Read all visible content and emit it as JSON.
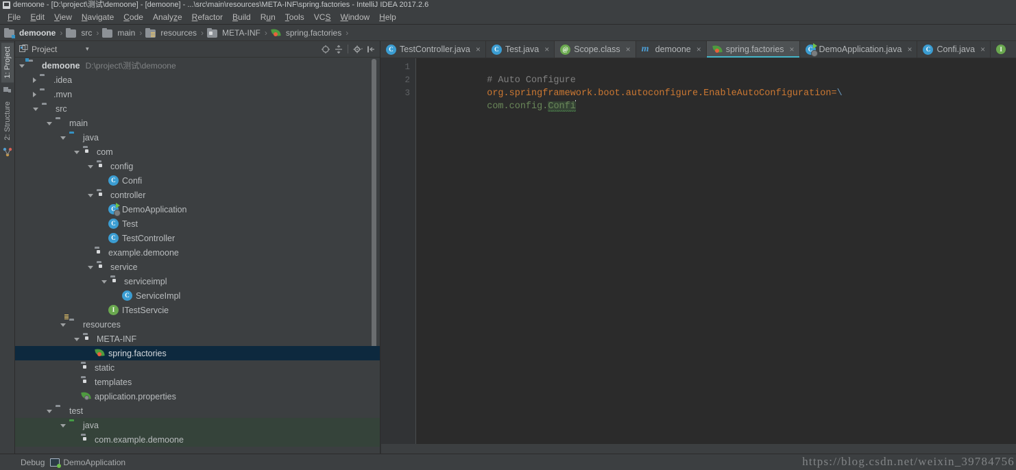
{
  "window": {
    "title": "demoone - [D:\\project\\测试\\demoone] - [demoone] - ...\\src\\main\\resources\\META-INF\\spring.factories - IntelliJ IDEA 2017.2.6",
    "app_icon": "intellij-idea-icon"
  },
  "menubar": {
    "items": [
      {
        "label": "File"
      },
      {
        "label": "Edit"
      },
      {
        "label": "View"
      },
      {
        "label": "Navigate"
      },
      {
        "label": "Code"
      },
      {
        "label": "Analyze"
      },
      {
        "label": "Refactor"
      },
      {
        "label": "Build"
      },
      {
        "label": "Run"
      },
      {
        "label": "Tools"
      },
      {
        "label": "VCS"
      },
      {
        "label": "Window"
      },
      {
        "label": "Help"
      }
    ]
  },
  "navbar": {
    "crumbs": [
      {
        "label": "demoone",
        "icon": "module-folder-icon",
        "bold": true
      },
      {
        "label": "src",
        "icon": "folder-icon",
        "bold": false
      },
      {
        "label": "main",
        "icon": "folder-icon",
        "bold": false
      },
      {
        "label": "resources",
        "icon": "resources-folder-icon",
        "bold": false
      },
      {
        "label": "META-INF",
        "icon": "package-folder-icon",
        "bold": false
      },
      {
        "label": "spring.factories",
        "icon": "spring-leaf-icon",
        "bold": false
      }
    ],
    "separator": "›"
  },
  "toolstrip": {
    "left_tabs": [
      {
        "label": "1: Project",
        "active": true
      },
      {
        "label": "2: Structure",
        "active": false
      }
    ]
  },
  "project_panel": {
    "title": "Project",
    "title_icon": "project-view-icon",
    "dropdown_icon": "chevron-down-icon",
    "toolbar_buttons": [
      {
        "name": "locate-icon",
        "glyph": "⊕"
      },
      {
        "name": "collapse-all-icon",
        "glyph": "≡"
      },
      {
        "name": "settings-gear-icon",
        "glyph": "⚙"
      },
      {
        "name": "hide-panel-icon",
        "glyph": "⇤"
      }
    ],
    "tree": [
      {
        "indent": 0,
        "arrow": "open",
        "icon": "module-folder-icon",
        "label": "demoone",
        "path": "D:\\project\\测试\\demoone",
        "bold": true,
        "selected": false,
        "testmark": false
      },
      {
        "indent": 1,
        "arrow": "closed",
        "icon": "folder-icon",
        "label": ".idea",
        "path": "",
        "bold": false,
        "selected": false,
        "testmark": false
      },
      {
        "indent": 1,
        "arrow": "closed",
        "icon": "folder-icon",
        "label": ".mvn",
        "path": "",
        "bold": false,
        "selected": false,
        "testmark": false
      },
      {
        "indent": 1,
        "arrow": "open",
        "icon": "folder-icon",
        "label": "src",
        "path": "",
        "bold": false,
        "selected": false,
        "testmark": false
      },
      {
        "indent": 2,
        "arrow": "open",
        "icon": "folder-icon",
        "label": "main",
        "path": "",
        "bold": false,
        "selected": false,
        "testmark": false
      },
      {
        "indent": 3,
        "arrow": "open",
        "icon": "source-folder-icon",
        "label": "java",
        "path": "",
        "bold": false,
        "selected": false,
        "testmark": false
      },
      {
        "indent": 4,
        "arrow": "open",
        "icon": "package-folder-icon",
        "label": "com",
        "path": "",
        "bold": false,
        "selected": false,
        "testmark": false
      },
      {
        "indent": 5,
        "arrow": "open",
        "icon": "package-folder-icon",
        "label": "config",
        "path": "",
        "bold": false,
        "selected": false,
        "testmark": false
      },
      {
        "indent": 6,
        "arrow": "none",
        "icon": "java-class-icon",
        "label": "Confi",
        "path": "",
        "bold": false,
        "selected": false,
        "testmark": false
      },
      {
        "indent": 5,
        "arrow": "open",
        "icon": "package-folder-icon",
        "label": "controller",
        "path": "",
        "bold": false,
        "selected": false,
        "testmark": false
      },
      {
        "indent": 6,
        "arrow": "none",
        "icon": "java-runnable-class-icon",
        "label": "DemoApplication",
        "path": "",
        "bold": false,
        "selected": false,
        "testmark": false
      },
      {
        "indent": 6,
        "arrow": "none",
        "icon": "java-class-icon",
        "label": "Test",
        "path": "",
        "bold": false,
        "selected": false,
        "testmark": false
      },
      {
        "indent": 6,
        "arrow": "none",
        "icon": "java-class-icon",
        "label": "TestController",
        "path": "",
        "bold": false,
        "selected": false,
        "testmark": false
      },
      {
        "indent": 5,
        "arrow": "none",
        "icon": "package-folder-icon",
        "label": "example.demoone",
        "path": "",
        "bold": false,
        "selected": false,
        "testmark": false
      },
      {
        "indent": 5,
        "arrow": "open",
        "icon": "package-folder-icon",
        "label": "service",
        "path": "",
        "bold": false,
        "selected": false,
        "testmark": false
      },
      {
        "indent": 6,
        "arrow": "open",
        "icon": "package-folder-icon",
        "label": "serviceimpl",
        "path": "",
        "bold": false,
        "selected": false,
        "testmark": false
      },
      {
        "indent": 7,
        "arrow": "none",
        "icon": "java-class-icon",
        "label": "ServiceImpl",
        "path": "",
        "bold": false,
        "selected": false,
        "testmark": false
      },
      {
        "indent": 6,
        "arrow": "none",
        "icon": "java-interface-icon",
        "label": "ITestServcie",
        "path": "",
        "bold": false,
        "selected": false,
        "testmark": false
      },
      {
        "indent": 3,
        "arrow": "open",
        "icon": "resources-folder-icon",
        "label": "resources",
        "path": "",
        "bold": false,
        "selected": false,
        "testmark": false
      },
      {
        "indent": 4,
        "arrow": "open",
        "icon": "package-folder-icon",
        "label": "META-INF",
        "path": "",
        "bold": false,
        "selected": false,
        "testmark": false
      },
      {
        "indent": 5,
        "arrow": "none",
        "icon": "spring-leaf-icon",
        "label": "spring.factories",
        "path": "",
        "bold": false,
        "selected": true,
        "testmark": false
      },
      {
        "indent": 4,
        "arrow": "none",
        "icon": "package-folder-icon",
        "label": "static",
        "path": "",
        "bold": false,
        "selected": false,
        "testmark": false
      },
      {
        "indent": 4,
        "arrow": "none",
        "icon": "package-folder-icon",
        "label": "templates",
        "path": "",
        "bold": false,
        "selected": false,
        "testmark": false
      },
      {
        "indent": 4,
        "arrow": "none",
        "icon": "spring-properties-icon",
        "label": "application.properties",
        "path": "",
        "bold": false,
        "selected": false,
        "testmark": false
      },
      {
        "indent": 2,
        "arrow": "open",
        "icon": "folder-icon",
        "label": "test",
        "path": "",
        "bold": false,
        "selected": false,
        "testmark": false
      },
      {
        "indent": 3,
        "arrow": "open",
        "icon": "test-source-folder-icon",
        "label": "java",
        "path": "",
        "bold": false,
        "selected": false,
        "testmark": true
      },
      {
        "indent": 4,
        "arrow": "none",
        "icon": "package-folder-icon",
        "label": "com.example.demoone",
        "path": "",
        "bold": false,
        "selected": false,
        "testmark": true
      }
    ]
  },
  "editor": {
    "tabs": [
      {
        "label": "TestController.java",
        "icon": "java-class-icon",
        "active": false,
        "close": "×"
      },
      {
        "label": "Test.java",
        "icon": "java-class-icon",
        "active": false,
        "close": "×"
      },
      {
        "label": "Scope.class",
        "icon": "java-annotation-icon",
        "active": false,
        "close": "×",
        "hover": true
      },
      {
        "label": "demoone",
        "icon": "maven-module-icon",
        "active": false,
        "close": "×"
      },
      {
        "label": "spring.factories",
        "icon": "spring-leaf-icon",
        "active": true,
        "close": "×"
      },
      {
        "label": "DemoApplication.java",
        "icon": "java-runnable-class-icon",
        "active": false,
        "close": "×"
      },
      {
        "label": "Confi.java",
        "icon": "java-class-icon",
        "active": false,
        "close": "×"
      }
    ],
    "overflow_tab_icon": "java-interface-icon",
    "gutter_lines": [
      "1",
      "2",
      "3"
    ],
    "code": {
      "line1_comment": "# Auto Configure",
      "line2_key": "org.springframework.boot.autoconfigure.EnableAutoConfiguration=",
      "line2_escape": "\\",
      "line3_prefix": "com.config.",
      "line3_highlighted": "Confi"
    }
  },
  "statusbar": {
    "items": [
      {
        "label": "Debug",
        "icon": ""
      },
      {
        "label": "DemoApplication",
        "icon": "debug-console-icon"
      }
    ]
  },
  "watermark": {
    "text": "https://blog.csdn.net/weixin_39784756"
  },
  "colors": {
    "chrome_bg": "#3c3f41",
    "editor_bg": "#2b2b2b",
    "gutter_bg": "#313335",
    "selection_blue": "#0d293e",
    "test_source_green": "#35433a",
    "tab_active": "#4e5254",
    "tab_underline": "#43b4c8",
    "text": "#b9bcbe",
    "comment": "#808080",
    "key_orange": "#cc7832",
    "value_green": "#6a8759",
    "escape_blue": "#6897bb"
  }
}
